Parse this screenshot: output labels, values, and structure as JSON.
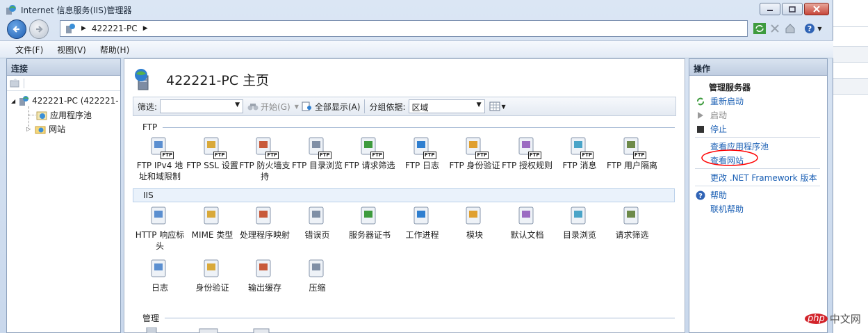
{
  "window": {
    "title": "Internet 信息服务(IIS)管理器"
  },
  "address": {
    "crumb": "422221-PC"
  },
  "menu": [
    "文件(F)",
    "视图(V)",
    "帮助(H)"
  ],
  "connections": {
    "header": "连接",
    "tree": [
      {
        "label": "422221-PC (422221-"
      },
      {
        "label": "应用程序池"
      },
      {
        "label": "网站"
      }
    ]
  },
  "main": {
    "title": "422221-PC 主页",
    "filter": {
      "label": "筛选:",
      "start": "开始(G)",
      "show_all": "全部显示(A)",
      "group_label": "分组依据:",
      "group_value": "区域"
    },
    "groups": {
      "ftp": "FTP",
      "iis": "IIS",
      "mgmt": "管理"
    },
    "ftp_features": [
      "FTP IPv4 地址和域限制",
      "FTP SSL 设置",
      "FTP 防火墙支持",
      "FTP 目录浏览",
      "FTP 请求筛选",
      "FTP 日志",
      "FTP 身份验证",
      "FTP 授权规则",
      "FTP 消息",
      "FTP 用户隔离"
    ],
    "iis_features": [
      "HTTP 响应标头",
      "MIME 类型",
      "处理程序映射",
      "错误页",
      "服务器证书",
      "工作进程",
      "模块",
      "默认文档",
      "目录浏览",
      "请求筛选",
      "日志",
      "身份验证",
      "输出缓存",
      "压缩"
    ]
  },
  "actions": {
    "header": "操作",
    "section": "管理服务器",
    "restart": "重新启动",
    "start": "启动",
    "stop": "停止",
    "view_pools": "查看应用程序池",
    "view_sites": "查看网站",
    "change_net": "更改 .NET Framework 版本",
    "help": "帮助",
    "online_help": "联机帮助"
  },
  "watermark": {
    "brand": "php",
    "text": "中文网"
  },
  "colors": {
    "link": "#1a5fb4",
    "accent": "#ff0000"
  }
}
